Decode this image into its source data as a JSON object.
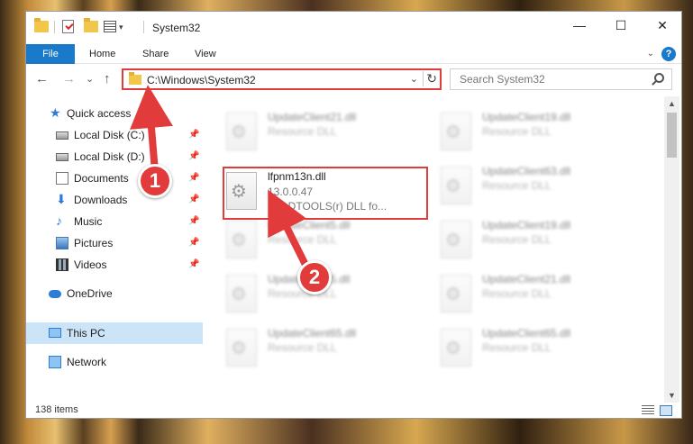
{
  "window": {
    "title": "System32",
    "buttons": {
      "minimize": "—",
      "maximize": "☐",
      "close": "✕"
    }
  },
  "quick_access_toolbar": {
    "dropdown": "▾",
    "separator": "|"
  },
  "ribbon": {
    "tabs": [
      "File",
      "Home",
      "Share",
      "View"
    ],
    "collapse": "⌄",
    "help": "?"
  },
  "nav": {
    "back": "←",
    "forward": "→",
    "recent": "⌄",
    "up": "↑",
    "address": "C:\\Windows\\System32",
    "address_dropdown": "⌄",
    "refresh": "↻",
    "search_placeholder": "Search System32"
  },
  "sidebar": {
    "items": [
      {
        "label": "Quick access",
        "icon": "star-icon",
        "pinned": false
      },
      {
        "label": "Local Disk (C:)",
        "icon": "disk-icon",
        "pinned": true
      },
      {
        "label": "Local Disk (D:)",
        "icon": "disk-icon",
        "pinned": true
      },
      {
        "label": "Documents",
        "icon": "documents-icon",
        "pinned": true
      },
      {
        "label": "Downloads",
        "icon": "downloads-icon",
        "pinned": true
      },
      {
        "label": "Music",
        "icon": "music-icon",
        "pinned": true
      },
      {
        "label": "Pictures",
        "icon": "pictures-icon",
        "pinned": true
      },
      {
        "label": "Videos",
        "icon": "videos-icon",
        "pinned": true
      },
      {
        "label": "OneDrive",
        "icon": "onedrive-icon",
        "pinned": false
      },
      {
        "label": "This PC",
        "icon": "this-pc-icon",
        "pinned": false,
        "selected": true
      },
      {
        "label": "Network",
        "icon": "network-icon",
        "pinned": false
      }
    ],
    "pin_glyph": "📌"
  },
  "files": {
    "highlighted": {
      "name": "lfpnm13n.dll",
      "version": "13.0.0.47",
      "description": "LEADTOOLS(r) DLL fo..."
    },
    "left_column": [
      {
        "name": "UpdateClient21.dll",
        "type": "Resource DLL"
      },
      {
        "name": "UpdateClient5.dll",
        "type": "Resource DLL"
      },
      {
        "name": "UpdateClient5.dll",
        "type": "Resource DLL"
      },
      {
        "name": "UpdateClient65.dll",
        "type": "Resource DLL"
      }
    ],
    "right_column": [
      {
        "name": "UpdateClient19.dll",
        "type": "Resource DLL"
      },
      {
        "name": "UpdateClient63.dll",
        "type": "Resource DLL"
      },
      {
        "name": "UpdateClient19.dll",
        "type": "Resource DLL"
      },
      {
        "name": "UpdateClient21.dll",
        "type": "Resource DLL"
      },
      {
        "name": "UpdateClient65.dll",
        "type": "Resource DLL"
      }
    ]
  },
  "scrollbar": {
    "up": "▲",
    "down": "▼"
  },
  "status": {
    "items_count": "138 items"
  },
  "annotations": {
    "step1": "1",
    "step2": "2",
    "color": "#e23b3b"
  }
}
